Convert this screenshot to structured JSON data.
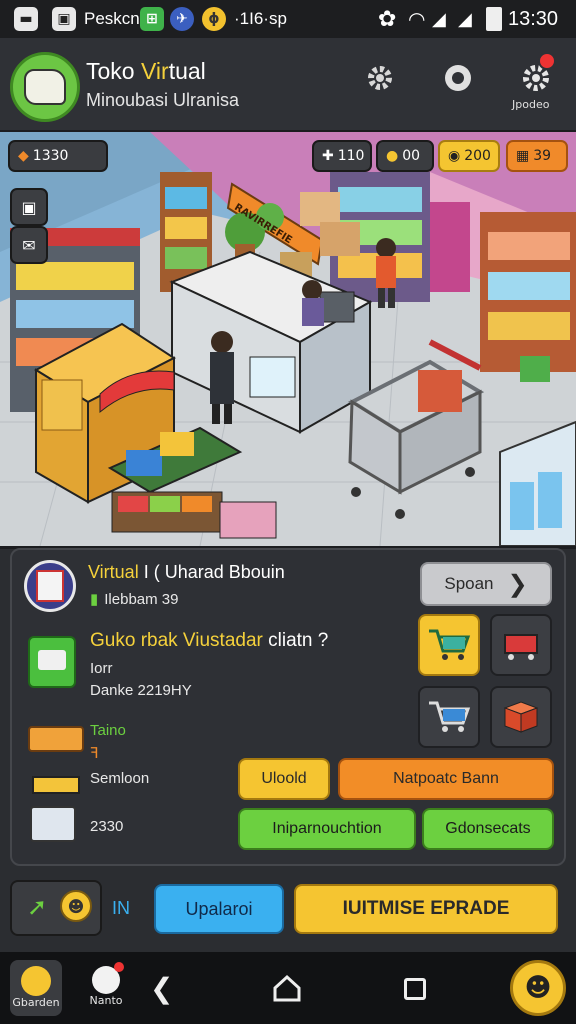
{
  "status_bar": {
    "app_label": "Peskcn",
    "extra_text": "·1I6·sp",
    "time": "13:30"
  },
  "header": {
    "title_part1": "Toko ",
    "title_accent": "Vir",
    "title_part2": "tual",
    "subtitle": "Minoubasi Ulranisa",
    "settings_label": "Jpodeo"
  },
  "resources": [
    {
      "icon": "dice-icon",
      "value": "1330"
    },
    {
      "icon": "sword-icon",
      "value": "110"
    },
    {
      "icon": "coin-icon",
      "value": "00"
    },
    {
      "icon": "gold-coin-icon",
      "value": "200"
    },
    {
      "icon": "crate-icon",
      "value": "39"
    }
  ],
  "scene": {
    "sign_left": "",
    "sign_center": "RAVIRREFIE"
  },
  "panel": {
    "store_name_accent": "Virtual",
    "store_name_rest": " I ( Uharad Bbouin",
    "store_sub": "Ilebbam 39",
    "spin_label": "Spoan",
    "feature_title_accent": "Guko rbak Viustadar",
    "feature_title_rest": " cliatn ?",
    "feature_line1": "Iorr",
    "feature_line2": "Danke 2219HY",
    "item_label": "Taino",
    "item_sub": "ꟻ",
    "item2_label": "Semloon",
    "item3_value": "2330",
    "btn_build": "Uloold",
    "btn_market": "Natpoatc Bann",
    "btn_info": "Iniparnouchtion",
    "btn_connect": "Gdonsecats"
  },
  "action_bar": {
    "label_in": "IN",
    "upgrade_small": "Upalaroi",
    "upgrade_big": "IUITMISE EPRADE"
  },
  "nav": {
    "left_label": "Gbarden",
    "second_label": "Nanto"
  },
  "colors": {
    "accent_yellow": "#f5c531",
    "accent_orange": "#f08a2a",
    "accent_green": "#6cd040",
    "accent_blue": "#3ab0f0"
  }
}
